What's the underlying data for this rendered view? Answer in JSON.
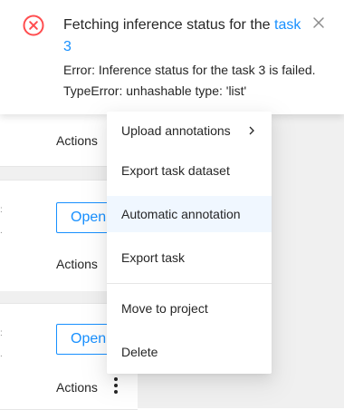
{
  "notification": {
    "title_prefix": "Fetching inference status for the ",
    "title_link": "task 3",
    "desc_line1": "Error: Inference status for the task 3 is failed.",
    "desc_line2": "TypeError: unhashable type: 'list'",
    "icon": "close-circle-icon",
    "close_icon": "close-icon",
    "error_color": "#ff4d4f",
    "link_color": "#1890ff"
  },
  "tasks": [
    {
      "actions_label": "Actions"
    },
    {
      "actions_label": "Actions",
      "open_label": "Open"
    },
    {
      "actions_label": "Actions",
      "open_label": "Open"
    }
  ],
  "menu": {
    "items": [
      {
        "label": "Upload annotations",
        "has_submenu": true
      },
      {
        "label": "Export task dataset"
      },
      {
        "label": "Automatic annotation",
        "active": true
      },
      {
        "label": "Export task"
      },
      {
        "label": "Move to project"
      },
      {
        "label": "Delete"
      }
    ]
  },
  "icons": {
    "kebab": "more-vertical-icon",
    "submenu": "chevron-right-icon"
  },
  "colors": {
    "primary": "#1890ff",
    "background": "#f0f0f0",
    "menu_active": "#f0f7ff"
  }
}
